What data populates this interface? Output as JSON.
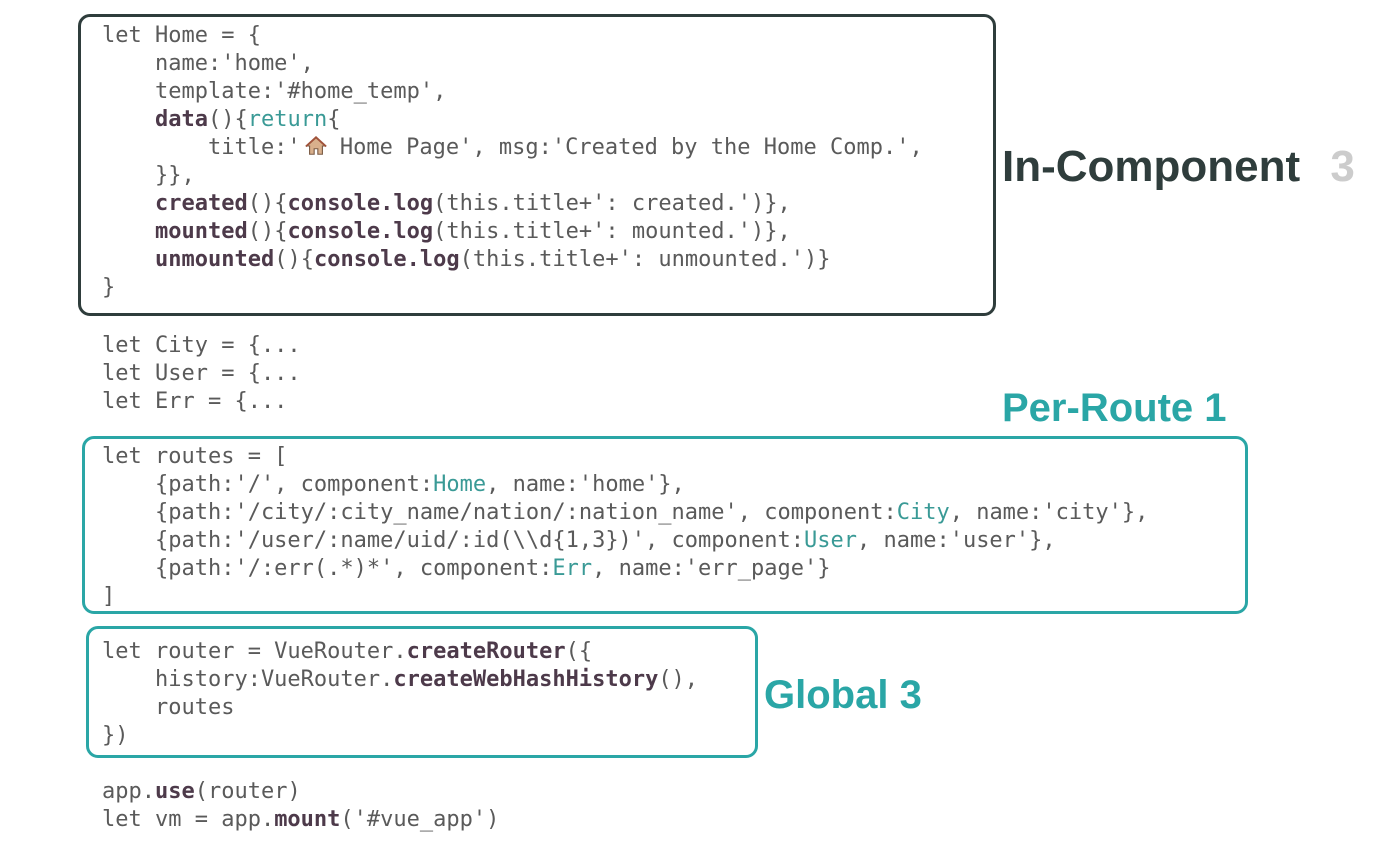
{
  "labels": {
    "in_component": "In-Component",
    "in_component_count": "3",
    "per_route": "Per-Route 1",
    "global": "Global 3"
  },
  "home_block": [
    [
      [
        "plain",
        "let Home = {"
      ]
    ],
    [
      [
        "plain",
        "    name:'home',"
      ]
    ],
    [
      [
        "plain",
        "    template:'#home_temp',"
      ]
    ],
    [
      [
        "plain",
        "    "
      ],
      [
        "fn",
        "data"
      ],
      [
        "plain",
        "(){"
      ],
      [
        "teal",
        "return"
      ],
      [
        "plain",
        "{"
      ]
    ],
    [
      [
        "plain",
        "        title:'"
      ],
      [
        "icon",
        "house-icon"
      ],
      [
        "plain",
        " Home Page', msg:'Created by the Home Comp.',"
      ]
    ],
    [
      [
        "plain",
        "    }},"
      ]
    ],
    [
      [
        "plain",
        "    "
      ],
      [
        "fn",
        "created"
      ],
      [
        "plain",
        "(){"
      ],
      [
        "fn",
        "console.log"
      ],
      [
        "plain",
        "(this.title+': created.')},"
      ]
    ],
    [
      [
        "plain",
        "    "
      ],
      [
        "fn",
        "mounted"
      ],
      [
        "plain",
        "(){"
      ],
      [
        "fn",
        "console.log"
      ],
      [
        "plain",
        "(this.title+': mounted.')},"
      ]
    ],
    [
      [
        "plain",
        "    "
      ],
      [
        "fn",
        "unmounted"
      ],
      [
        "plain",
        "(){"
      ],
      [
        "fn",
        "console.log"
      ],
      [
        "plain",
        "(this.title+': unmounted.')}"
      ]
    ],
    [
      [
        "plain",
        "}"
      ]
    ]
  ],
  "other_components": [
    "let City = {...",
    "let User = {...",
    "let Err = {..."
  ],
  "routes_block": [
    [
      [
        "plain",
        "let routes = ["
      ]
    ],
    [
      [
        "plain",
        "    {path:'/', component:"
      ],
      [
        "teal",
        "Home"
      ],
      [
        "plain",
        ", name:'home'},"
      ]
    ],
    [
      [
        "plain",
        "    {path:'/city/:city_name/nation/:nation_name', component:"
      ],
      [
        "teal",
        "City"
      ],
      [
        "plain",
        ", name:'city'},"
      ]
    ],
    [
      [
        "plain",
        "    {path:'/user/:name/uid/:id(\\\\d{1,3})', component:"
      ],
      [
        "teal",
        "User"
      ],
      [
        "plain",
        ", name:'user'},"
      ]
    ],
    [
      [
        "plain",
        "    {path:'/:err(.*)*', component:"
      ],
      [
        "teal",
        "Err"
      ],
      [
        "plain",
        ", name:'err_page'}"
      ]
    ],
    [
      [
        "plain",
        "]"
      ]
    ]
  ],
  "router_block": [
    [
      [
        "plain",
        "let router = VueRouter."
      ],
      [
        "fn",
        "createRouter"
      ],
      [
        "plain",
        "({"
      ]
    ],
    [
      [
        "plain",
        "    history:VueRouter."
      ],
      [
        "fn",
        "createWebHashHistory"
      ],
      [
        "plain",
        "(),"
      ]
    ],
    [
      [
        "plain",
        "    routes"
      ]
    ],
    [
      [
        "plain",
        "})"
      ]
    ]
  ],
  "app_block": [
    [
      [
        "plain",
        "app."
      ],
      [
        "fn",
        "use"
      ],
      [
        "plain",
        "(router)"
      ]
    ],
    [
      [
        "plain",
        "let vm = app."
      ],
      [
        "fn",
        "mount"
      ],
      [
        "plain",
        "('#vue_app')"
      ]
    ]
  ]
}
